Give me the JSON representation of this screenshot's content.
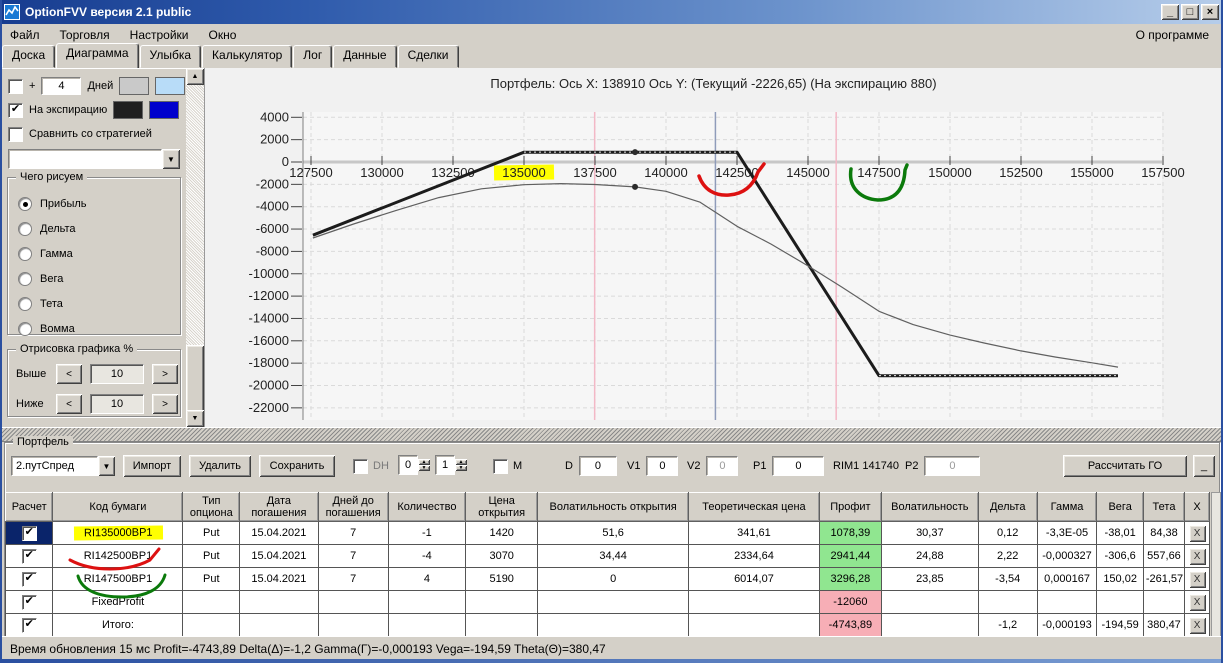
{
  "window": {
    "title": "OptionFVV версия 2.1 public",
    "controls": {
      "minimize": "_",
      "maximize": "□",
      "close": "×"
    }
  },
  "menu": {
    "items": [
      "Файл",
      "Торговля",
      "Настройки",
      "Окно"
    ],
    "right": "О программе"
  },
  "tabs": {
    "items": [
      "Доска",
      "Диаграмма",
      "Улыбка",
      "Калькулятор",
      "Лог",
      "Данные",
      "Сделки"
    ],
    "active": "Диаграмма"
  },
  "sidebar": {
    "days_row": {
      "checked": false,
      "plus": "+",
      "value": "4",
      "label": "Дней",
      "swatch1": "#c9c9c9",
      "swatch2": "#b8dcf8"
    },
    "expiry_row": {
      "checked": true,
      "label": "На экспирацию",
      "swatch1": "#1f1f1f",
      "swatch2": "#0000cc"
    },
    "compare_row": {
      "checked": false,
      "label": "Сравнить со стратегией"
    },
    "strategy_dropdown_value": "",
    "draw_group": {
      "title": "Чего рисуем",
      "options": [
        "Прибыль",
        "Дельта",
        "Гамма",
        "Вега",
        "Тета",
        "Вомма"
      ],
      "selected": "Прибыль"
    },
    "render_group": {
      "title": "Отрисовка графика %",
      "dec": "<",
      "inc": ">",
      "rows": [
        {
          "label": "Выше",
          "value": "10"
        },
        {
          "label": "Ниже",
          "value": "10"
        }
      ]
    }
  },
  "chart_data": {
    "type": "line",
    "title": "Портфель: Ось X: 138910 Ось Y:  (Текущий -2226,65)  (На экспирацию 880)",
    "x_ticks": [
      127500,
      130000,
      132500,
      135000,
      137500,
      140000,
      142500,
      145000,
      147500,
      150000,
      152500,
      155000,
      157500
    ],
    "y_ticks": [
      4000,
      2000,
      0,
      -2000,
      -4000,
      -6000,
      -8000,
      -10000,
      -12000,
      -14000,
      -16000,
      -18000,
      -20000,
      -22000
    ],
    "highlighted_x_tick": 135000,
    "xlim": [
      127360,
      157700
    ],
    "ylim": [
      -22000,
      4000
    ],
    "grid": true,
    "series": [
      {
        "name": "expiration-payoff",
        "color": "#1c1c1c",
        "width": 3,
        "points": [
          [
            127566,
            -6554
          ],
          [
            135000,
            880
          ],
          [
            142500,
            880
          ],
          [
            147500,
            -19120
          ],
          [
            155914,
            -19120
          ]
        ]
      },
      {
        "name": "current-value",
        "color": "#606060",
        "width": 1.2,
        "points": [
          [
            127566,
            -6800
          ],
          [
            129000,
            -5550
          ],
          [
            130500,
            -4330
          ],
          [
            132000,
            -3190
          ],
          [
            133500,
            -2400
          ],
          [
            135000,
            -2030
          ],
          [
            136300,
            -1930
          ],
          [
            137500,
            -2010
          ],
          [
            138910,
            -2227
          ],
          [
            140000,
            -2620
          ],
          [
            141200,
            -3600
          ],
          [
            142500,
            -5750
          ],
          [
            143700,
            -7350
          ],
          [
            145000,
            -9300
          ],
          [
            146200,
            -11200
          ],
          [
            147500,
            -13360
          ],
          [
            148700,
            -14550
          ],
          [
            150000,
            -15490
          ],
          [
            151200,
            -16200
          ],
          [
            152500,
            -16900
          ],
          [
            153700,
            -17450
          ],
          [
            155000,
            -17970
          ],
          [
            155914,
            -18350
          ]
        ]
      }
    ],
    "markers": [
      [
        138910,
        880
      ],
      [
        138910,
        -2226.65
      ]
    ],
    "vlines": [
      {
        "x": 137488,
        "color": "#f3b8c6"
      },
      {
        "x": 141740,
        "color": "#8f9cba"
      },
      {
        "x": 145992,
        "color": "#f3b8c6"
      }
    ]
  },
  "portfolio": {
    "group_label": "Портфель",
    "combo_value": "2.путСпред",
    "import_btn": "Импорт",
    "delete_btn": "Удалить",
    "save_btn": "Сохранить",
    "dh": {
      "label": "DH",
      "spin1": "0",
      "spin2": "1"
    },
    "m_label": "M",
    "d": {
      "label": "D",
      "value": "0"
    },
    "v1": {
      "label": "V1",
      "value": "0"
    },
    "v2": {
      "label": "V2",
      "value": "0"
    },
    "p1": {
      "label": "P1",
      "value": "0"
    },
    "rim_label": "RIM1 141740",
    "p2": {
      "label": "P2",
      "value": "0"
    },
    "calc_btn": "Рассчитать ГО",
    "collapse_btn": "_"
  },
  "table": {
    "headers": [
      "Расчет",
      "Код бумаги",
      "Тип опциона",
      "Дата погашения",
      "Дней до погашения",
      "Количество",
      "Цена открытия",
      "Волатильность открытия",
      "Теоретическая цена",
      "Профит",
      "Волатильность",
      "Дельта",
      "Гамма",
      "Вега",
      "Тета",
      "X"
    ],
    "rows": [
      {
        "checked": true,
        "focus": true,
        "mark": "yellow",
        "profit": "green",
        "cells": [
          "",
          "RI135000BP1",
          "Put",
          "15.04.2021",
          "7",
          "-1",
          "1420",
          "51,6",
          "341,61",
          "1078,39",
          "30,37",
          "0,12",
          "-3,3E-05",
          "-38,01",
          "84,38",
          "X"
        ]
      },
      {
        "checked": true,
        "focus": false,
        "mark": "red",
        "profit": "green",
        "cells": [
          "",
          "RI142500BP1",
          "Put",
          "15.04.2021",
          "7",
          "-4",
          "3070",
          "34,44",
          "2334,64",
          "2941,44",
          "24,88",
          "2,22",
          "-0,000327",
          "-306,6",
          "557,66",
          "X"
        ]
      },
      {
        "checked": true,
        "focus": false,
        "mark": "green",
        "profit": "green",
        "cells": [
          "",
          "RI147500BP1",
          "Put",
          "15.04.2021",
          "7",
          "4",
          "5190",
          "0",
          "6014,07",
          "3296,28",
          "23,85",
          "-3,54",
          "0,000167",
          "150,02",
          "-261,57",
          "X"
        ]
      },
      {
        "checked": true,
        "focus": false,
        "mark": null,
        "profit": "pink",
        "cells": [
          "",
          "FixedProfit",
          "",
          "",
          "",
          "",
          "",
          "",
          "",
          "-12060",
          "",
          "",
          "",
          "",
          "",
          "X"
        ]
      },
      {
        "checked": true,
        "focus": false,
        "mark": null,
        "profit": "pink",
        "cells": [
          "",
          "Итого:",
          "",
          "",
          "",
          "",
          "",
          "",
          "",
          "-4743,89",
          "",
          "-1,2",
          "-0,000193",
          "-194,59",
          "380,47",
          "X"
        ]
      }
    ]
  },
  "status": {
    "text": "Время обновления 15 мс  Profit=-4743,89 Delta(Δ)=-1,2 Gamma(Г)=-0,000193 Vega=-194,59 Theta(Θ)=380,47"
  },
  "colors": {
    "profit_green": "#90e690",
    "loss_pink": "#f7aeb6",
    "highlight_yellow": "#ffff00",
    "annotation_red": "#dd1111",
    "annotation_green": "#0b7a0b"
  }
}
